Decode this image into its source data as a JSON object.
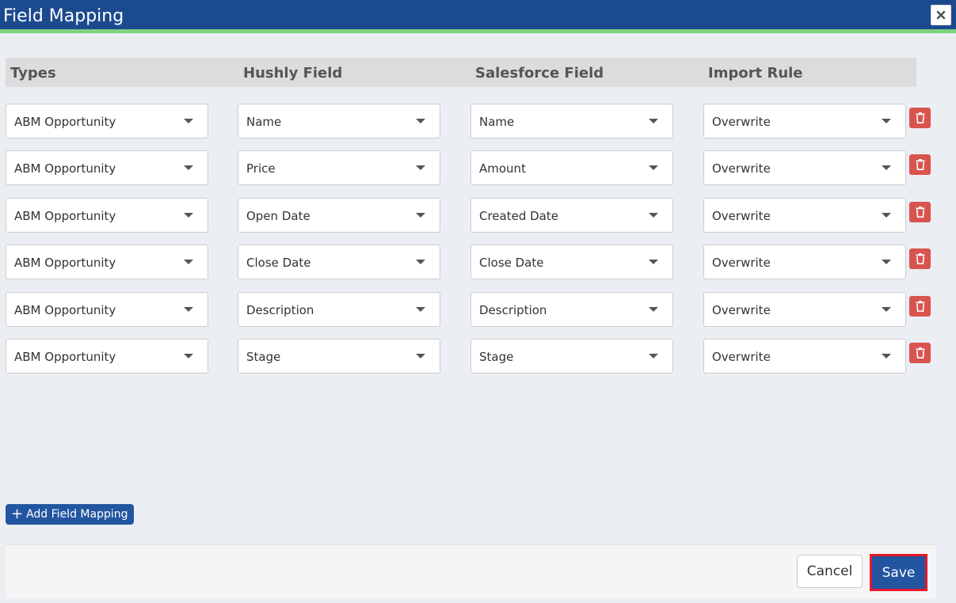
{
  "modal": {
    "title": "Field Mapping"
  },
  "columns": {
    "types": "Types",
    "hushly_field": "Hushly Field",
    "salesforce_field": "Salesforce Field",
    "import_rule": "Import Rule"
  },
  "rows": [
    {
      "type": "ABM Opportunity",
      "hushly": "Name",
      "salesforce": "Name",
      "rule": "Overwrite"
    },
    {
      "type": "ABM Opportunity",
      "hushly": "Price",
      "salesforce": "Amount",
      "rule": "Overwrite"
    },
    {
      "type": "ABM Opportunity",
      "hushly": "Open Date",
      "salesforce": "Created Date",
      "rule": "Overwrite"
    },
    {
      "type": "ABM Opportunity",
      "hushly": "Close Date",
      "salesforce": "Close Date",
      "rule": "Overwrite"
    },
    {
      "type": "ABM Opportunity",
      "hushly": "Description",
      "salesforce": "Description",
      "rule": "Overwrite"
    },
    {
      "type": "ABM Opportunity",
      "hushly": "Stage",
      "salesforce": "Stage",
      "rule": "Overwrite"
    }
  ],
  "actions": {
    "add_label": "Add Field Mapping",
    "cancel_label": "Cancel",
    "save_label": "Save"
  },
  "icons": {
    "close": "close-icon",
    "delete": "trash-icon",
    "add": "plus-icon",
    "dropdown": "caret-down-icon"
  },
  "colors": {
    "header_bg": "#1c4a8e",
    "header_accent": "#7fd37f",
    "primary": "#2356a0",
    "danger": "#d9534f",
    "save_highlight": "#e8182a"
  }
}
